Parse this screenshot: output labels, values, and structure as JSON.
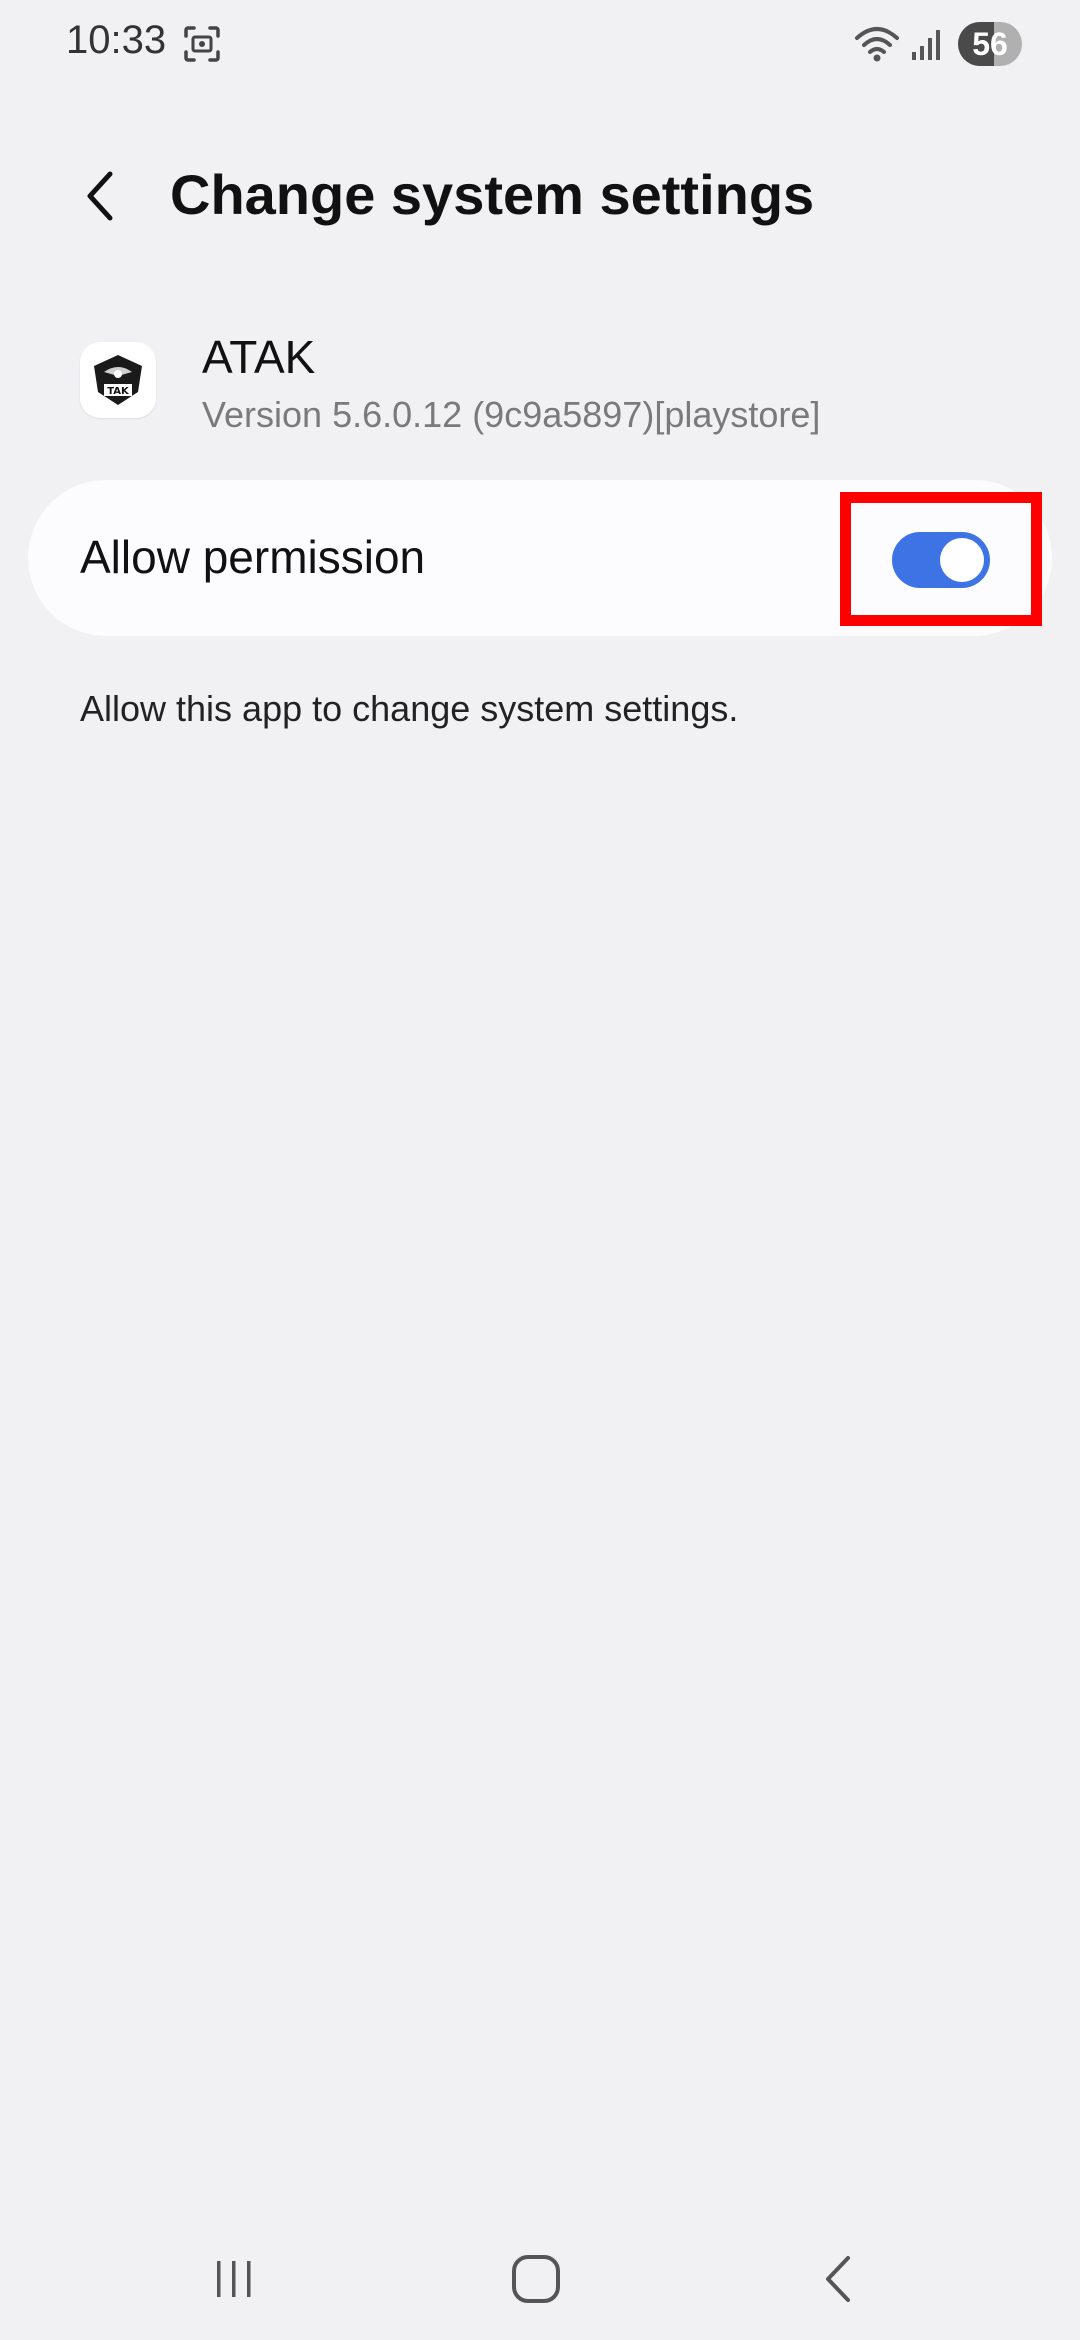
{
  "status_bar": {
    "time": "10:33",
    "battery_level": "56",
    "battery_fraction": 0.56,
    "icons": [
      "screenshot-icon",
      "wifi-icon",
      "signal-icon",
      "battery-icon"
    ]
  },
  "header": {
    "title": "Change system settings",
    "back_icon": "chevron-left-icon"
  },
  "app": {
    "name": "ATAK",
    "version": "Version 5.6.0.12 (9c9a5897)[playstore]",
    "icon_text": "TAK"
  },
  "permission": {
    "label": "Allow permission",
    "enabled": true
  },
  "description": "Allow this app to change system settings.",
  "navigation": {
    "buttons": [
      "recent-apps-icon",
      "home-icon",
      "back-icon"
    ]
  },
  "colors": {
    "background": "#f1f1f4",
    "card": "#fcfcfe",
    "toggle_on": "#3e73e6",
    "highlight": "#ff0000"
  }
}
